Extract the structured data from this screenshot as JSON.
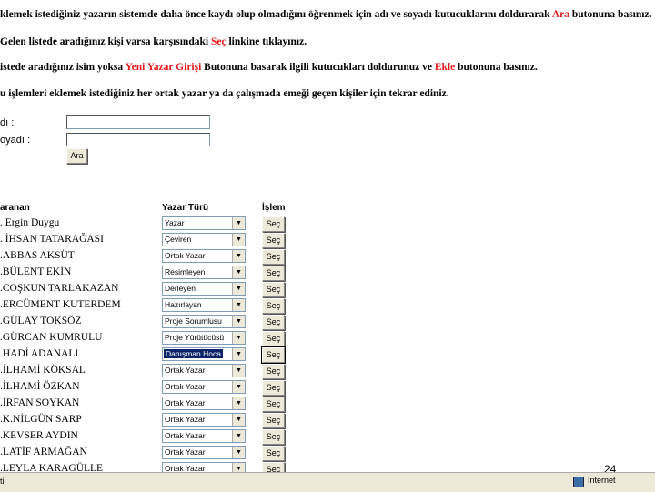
{
  "instructions": {
    "line1": {
      "a": "klemek istediğiniz yazarın sistemde daha önce kaydı olup olmadığını öğrenmek için adı ve soyadı kutucuklarını doldurarak ",
      "red": "Ara",
      "b": " butonuna basınız."
    },
    "line2": {
      "a": "Gelen listede aradığınız kişi varsa karşısındaki ",
      "red": "Seç",
      "b": " linkine tıklayınız."
    },
    "line3": {
      "a": "istede aradığınız isim yoksa ",
      "red": "Yeni Yazar Girişi",
      "b": " Butonuna basarak ilgili kutucukları doldurunuz ve ",
      "red2": "Ekle",
      "c": " butonuna basınız."
    },
    "line4": "u işlemleri eklemek istediğiniz her ortak yazar ya da çalışmada emeği geçen kişiler için tekrar ediniz."
  },
  "form": {
    "name_label": "dı :",
    "surname_label": "oyadı :",
    "name_value": "",
    "surname_value": "",
    "search_button": "Ara"
  },
  "table": {
    "headers": {
      "name": "aranan",
      "type": "Yazar Türü",
      "action": "İşlem"
    },
    "select_label": "Seç",
    "rows": [
      {
        "name": ". Ergin Duygu",
        "type": "Yazar"
      },
      {
        "name": ". İHSAN TATARAĞASI",
        "type": "Çeviren"
      },
      {
        "name": ".ABBAS AKSÜT",
        "type": "Ortak Yazar"
      },
      {
        "name": ".BÜLENT EKİN",
        "type": "Resimleyen"
      },
      {
        "name": ".COŞKUN TARLAKAZAN",
        "type": "Derleyen"
      },
      {
        "name": ".ERCÜMENT KUTERDEM",
        "type": "Hazırlayan"
      },
      {
        "name": ".GÜLAY TOKSÖZ",
        "type": "Proje Sorumlusu"
      },
      {
        "name": ".GÜRCAN KUMRULU",
        "type": "Proje Yürütücüsü"
      },
      {
        "name": ".HADİ ADANALI",
        "type": "Danışman Hoca",
        "highlight": true
      },
      {
        "name": ".İLHAMİ KÖKSAL",
        "type": "Ortak Yazar"
      },
      {
        "name": ".İLHAMİ ÖZKAN",
        "type": "Ortak Yazar"
      },
      {
        "name": ".İRFAN SOYKAN",
        "type": "Ortak Yazar"
      },
      {
        "name": ".K.NİLGÜN SARP",
        "type": "Ortak Yazar"
      },
      {
        "name": ".KEVSER AYDIN",
        "type": "Ortak Yazar"
      },
      {
        "name": ".LATİF ARMAĞAN",
        "type": "Ortak Yazar"
      },
      {
        "name": ".LEYLA KARAGÜLLE",
        "type": "Ortak Yazar"
      }
    ]
  },
  "statusbar": {
    "left": "ti",
    "zone": "Internet"
  },
  "page_number": "24"
}
